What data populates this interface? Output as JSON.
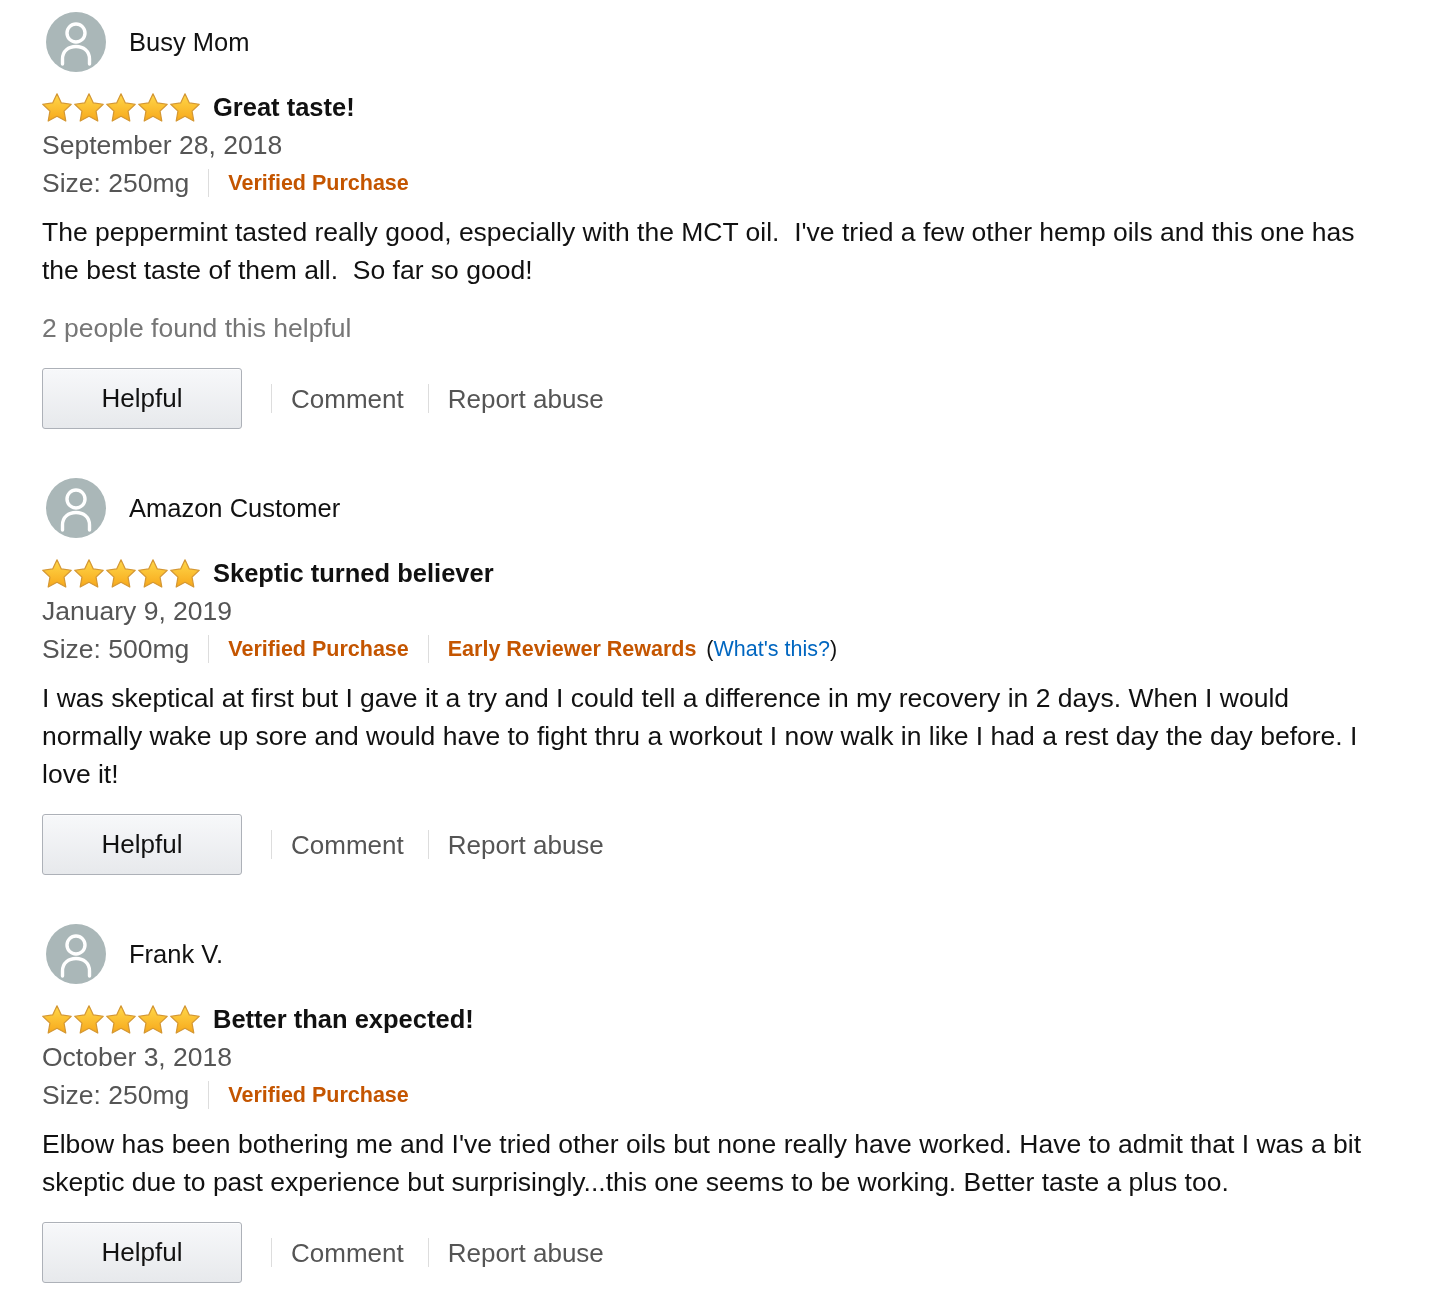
{
  "reviews": [
    {
      "reviewer": "Busy Mom",
      "stars": 5,
      "title": "Great taste!",
      "date": "September 28, 2018",
      "size": "Size: 250mg",
      "labels": [
        {
          "text": "Verified Purchase"
        }
      ],
      "body": "The peppermint tasted really good, especially with the MCT oil.  I've tried a few other hemp oils and this one has the best taste of them all.  So far so good!",
      "helpful_count": "2 people found this helpful",
      "actions": {
        "helpful": "Helpful",
        "comment": "Comment",
        "report": "Report abuse"
      }
    },
    {
      "reviewer": "Amazon Customer",
      "stars": 5,
      "title": "Skeptic turned believer",
      "date": "January 9, 2019",
      "size": "Size: 500mg",
      "labels": [
        {
          "text": "Verified Purchase"
        },
        {
          "text": "Early Reviewer Rewards"
        }
      ],
      "info_link": {
        "open": "(",
        "text": "What's this?",
        "close": ")"
      },
      "body": "I was skeptical at first but I gave it a try and I could tell a difference in my recovery in 2 days. When I would normally wake up sore and would have to fight thru a workout I now walk in like I had a rest day the day before. I love it!",
      "actions": {
        "helpful": "Helpful",
        "comment": "Comment",
        "report": "Report abuse"
      }
    },
    {
      "reviewer": "Frank V.",
      "stars": 5,
      "title": "Better than expected!",
      "date": "October 3, 2018",
      "size": "Size: 250mg",
      "labels": [
        {
          "text": "Verified Purchase"
        }
      ],
      "body": "Elbow has been bothering me and I've tried other oils but none really have worked. Have to admit that I was a bit skeptic due to past experience but surprisingly...this one seems to be working. Better taste a plus too.",
      "actions": {
        "helpful": "Helpful",
        "comment": "Comment",
        "report": "Report abuse"
      }
    }
  ]
}
